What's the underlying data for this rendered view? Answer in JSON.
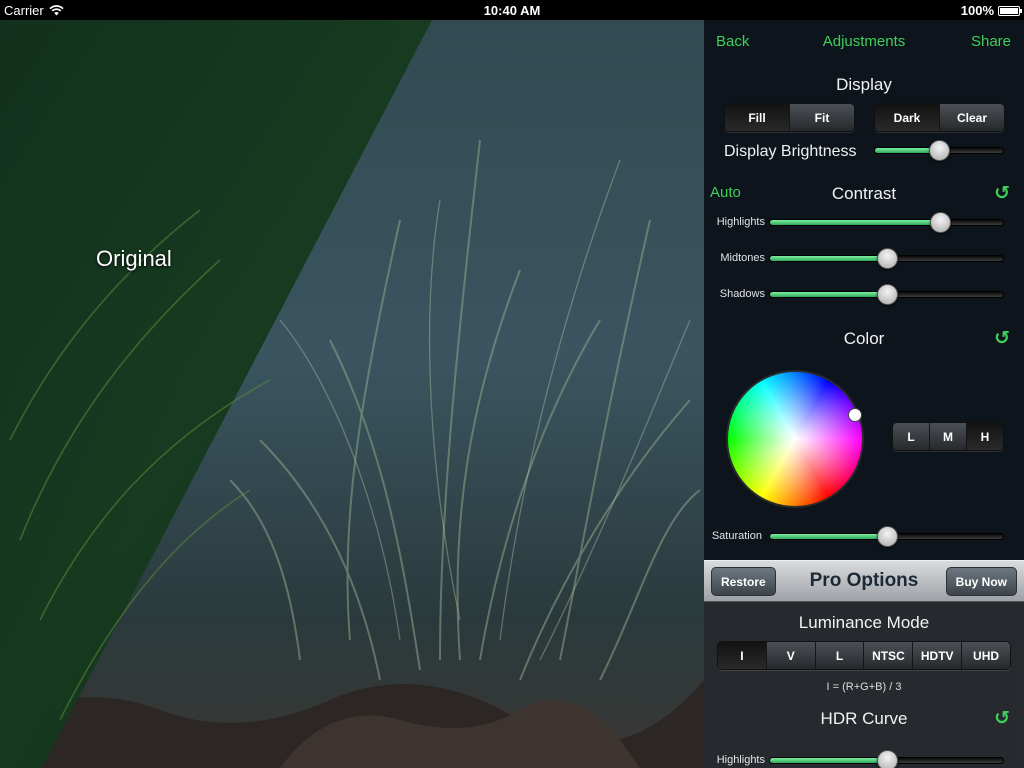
{
  "status_bar": {
    "carrier": "Carrier",
    "time": "10:40 AM",
    "battery": "100%"
  },
  "photo": {
    "overlay_label": "Original"
  },
  "nav": {
    "back": "Back",
    "title": "Adjustments",
    "share": "Share"
  },
  "display": {
    "title": "Display",
    "fill_fit": [
      "Fill",
      "Fit"
    ],
    "fill_fit_selected": "Fill",
    "dark_clear": [
      "Dark",
      "Clear"
    ],
    "dark_clear_selected": "Dark",
    "brightness_label": "Display Brightness",
    "brightness_value": 0.5
  },
  "contrast": {
    "auto": "Auto",
    "title": "Contrast",
    "highlights_label": "Highlights",
    "highlights_value": 0.73,
    "midtones_label": "Midtones",
    "midtones_value": 0.5,
    "shadows_label": "Shadows",
    "shadows_value": 0.5
  },
  "color": {
    "title": "Color",
    "range_buttons": [
      "L",
      "M",
      "H"
    ],
    "range_selected": "H",
    "saturation_label": "Saturation",
    "saturation_value": 0.5
  },
  "pro": {
    "restore": "Restore",
    "title": "Pro Options",
    "buy": "Buy Now",
    "luminance_title": "Luminance Mode",
    "luminance_modes": [
      "I",
      "V",
      "L",
      "NTSC",
      "HDTV",
      "UHD"
    ],
    "luminance_selected": "I",
    "formula": "I = (R+G+B) / 3",
    "hdr_title": "HDR Curve",
    "hdr_highlights_label": "Highlights",
    "hdr_highlights_value": 0.5
  },
  "colors": {
    "accent_green": "#3ecf5a",
    "slider_fill": "#56d987"
  },
  "icons": {
    "reset": "reset-arrow-icon",
    "wifi": "wifi-icon",
    "battery": "battery-icon"
  }
}
